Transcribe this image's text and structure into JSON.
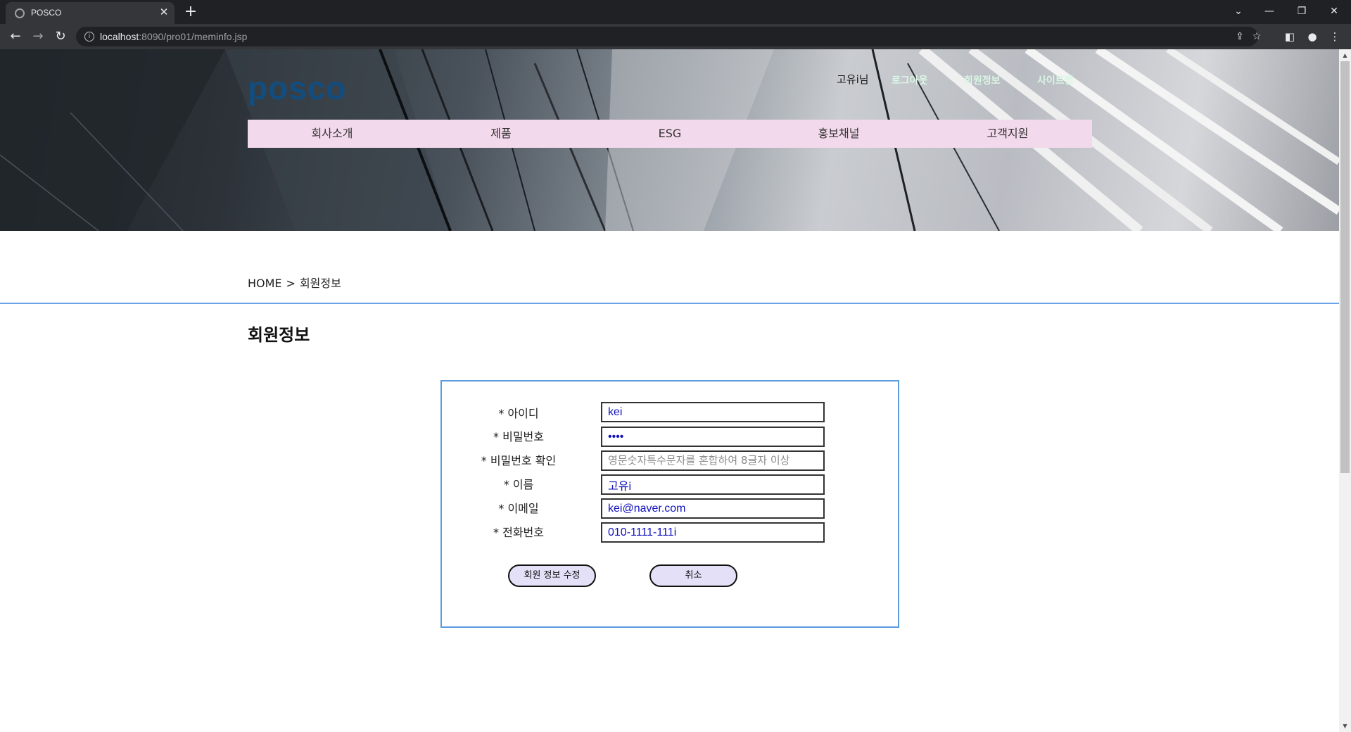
{
  "browser": {
    "tab_title": "POSCO",
    "url_host": "localhost",
    "url_rest": ":8090/pro01/meminfo.jsp"
  },
  "header": {
    "logo": "posco",
    "user_greeting": "고유i님",
    "links": [
      "로그아웃",
      "회원정보",
      "사이트맵"
    ]
  },
  "nav": {
    "items": [
      "회사소개",
      "제품",
      "ESG",
      "홍보채널",
      "고객지원"
    ]
  },
  "breadcrumb": {
    "home": "HOME",
    "separator": ">",
    "current": "회원정보"
  },
  "page": {
    "title": "회원정보"
  },
  "form": {
    "id_label": "* 아이디",
    "id_value": "kei",
    "pw_label": "* 비밀번호",
    "pw_value": "••••",
    "pw_confirm_label": "* 비밀번호 확인",
    "pw_confirm_placeholder": "영문숫자특수문자를 혼합하여 8글자 이상",
    "name_label": "* 이름",
    "name_value": "고유i",
    "email_label": "* 이메일",
    "email_value": "kei@naver.com",
    "phone_label": "* 전화번호",
    "phone_value": "010-1111-111i",
    "submit_label": "회원 정보 수정",
    "cancel_label": "취소"
  },
  "colors": {
    "nav_bg": "#f3d9ec",
    "divider": "#6aa3e6",
    "form_border": "#5a9bdc",
    "button_bg": "#e4e0f8",
    "logo": "#0f4f86",
    "header_link": "#d9f7e4"
  }
}
